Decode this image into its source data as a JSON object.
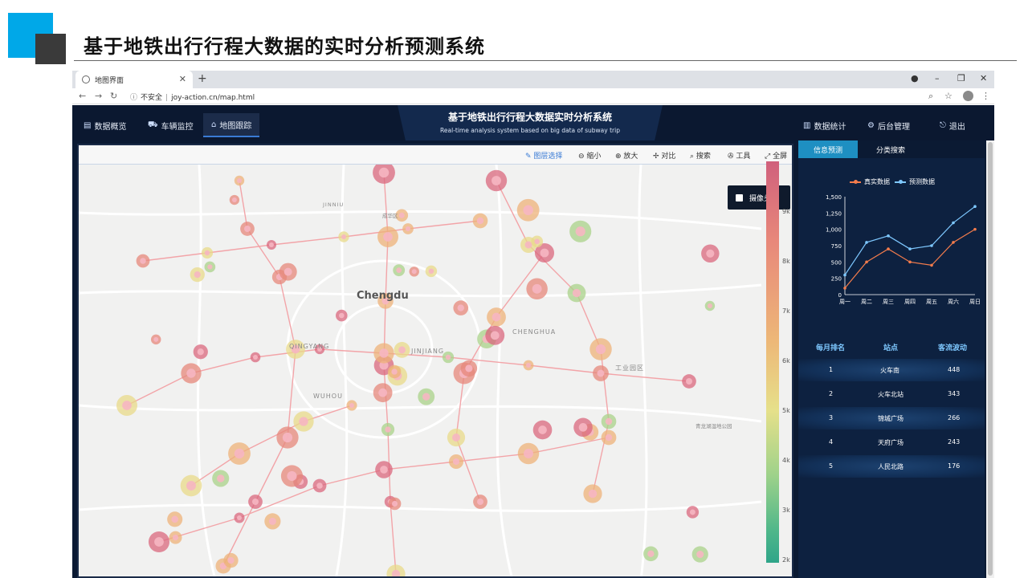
{
  "slide": {
    "title": "基于地铁出行行程大数据的实时分析预测系统"
  },
  "browser": {
    "tab_title": "地图界面",
    "new_tab": "+",
    "url_security": "不安全",
    "url": "joy-action.cn/map.html"
  },
  "app": {
    "nav_left": [
      {
        "label": "数据概览",
        "icon": "document-icon"
      },
      {
        "label": "车辆监控",
        "icon": "truck-icon"
      },
      {
        "label": "地图跟踪",
        "icon": "building-icon"
      }
    ],
    "banner_title": "基于地铁出行行程大数据实时分析系统",
    "banner_subtitle": "Real-time analysis system based on big data of subway trip",
    "nav_right": [
      {
        "label": "数据统计",
        "icon": "bar-chart-icon"
      },
      {
        "label": "后台管理",
        "icon": "gear-icon"
      },
      {
        "label": "退出",
        "icon": "exit-icon"
      }
    ]
  },
  "map": {
    "toolbar": [
      "图层选择",
      "缩小",
      "放大",
      "对比",
      "搜索",
      "工具",
      "全屏"
    ],
    "city_label": "Chengdu",
    "district_labels": [
      "QINGYANG",
      "JINJIANG",
      "CHENGHUA",
      "WUHOU",
      "工业园区",
      "青龙湖湿地公园",
      "JINNIU",
      "成华区"
    ],
    "camera_label": "摄像头",
    "colorbar_ticks": [
      "9k",
      "8k",
      "7k",
      "6k",
      "5k",
      "4k",
      "3k",
      "2k"
    ]
  },
  "right_panel": {
    "tabs": [
      "信息预测",
      "分类搜索"
    ],
    "legend": [
      {
        "name": "真实数据",
        "color": "#f47c4c"
      },
      {
        "name": "预测数据",
        "color": "#7ec8ff"
      }
    ],
    "ranking": {
      "headers": [
        "每月排名",
        "站点",
        "客流波动"
      ],
      "rows": [
        {
          "rank": "1",
          "station": "火车南",
          "value": "448"
        },
        {
          "rank": "2",
          "station": "火车北站",
          "value": "343"
        },
        {
          "rank": "3",
          "station": "锦城广场",
          "value": "266"
        },
        {
          "rank": "4",
          "station": "天府广场",
          "value": "243"
        },
        {
          "rank": "5",
          "station": "人民北路",
          "value": "176"
        }
      ]
    }
  },
  "chart_data": {
    "type": "line",
    "categories": [
      "周一",
      "周二",
      "周三",
      "周四",
      "周五",
      "周六",
      "周日"
    ],
    "series": [
      {
        "name": "真实数据",
        "values": [
          100,
          500,
          700,
          500,
          450,
          800,
          1000
        ]
      },
      {
        "name": "预测数据",
        "values": [
          300,
          800,
          900,
          700,
          750,
          1100,
          1350
        ]
      }
    ],
    "yticks": [
      "0",
      "250",
      "500",
      "750",
      "1,000",
      "1,250",
      "1,500"
    ],
    "ylim": [
      0,
      1500
    ]
  }
}
